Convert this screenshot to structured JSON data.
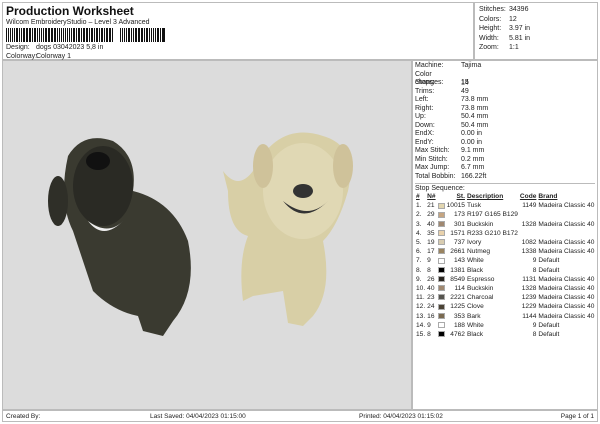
{
  "header": {
    "title": "Production Worksheet",
    "subtitle": "Wilcom EmbroideryStudio – Level 3 Advanced",
    "design_label": "Design:",
    "design_value": "dogs 03042023 5,8 in",
    "colorway_label": "Colorway:",
    "colorway_value": "Colorway 1"
  },
  "stats": [
    {
      "label": "Stitches:",
      "value": "34396"
    },
    {
      "label": "Colors:",
      "value": "12"
    },
    {
      "label": "Height:",
      "value": "3.97 in"
    },
    {
      "label": "Width:",
      "value": "5.81 in"
    },
    {
      "label": "Zoom:",
      "value": "1:1"
    }
  ],
  "info": [
    {
      "label": "Machine:",
      "value": "Tajima"
    },
    {
      "label": "Color changes:",
      "value": "14"
    },
    {
      "label": "Stops:",
      "value": "15"
    },
    {
      "label": "Trims:",
      "value": "49"
    },
    {
      "label": "Left:",
      "value": "73.8 mm"
    },
    {
      "label": "Right:",
      "value": "73.8 mm"
    },
    {
      "label": "Up:",
      "value": "50.4 mm"
    },
    {
      "label": "Down:",
      "value": "50.4 mm"
    },
    {
      "label": "EndX:",
      "value": "0.00 in"
    },
    {
      "label": "EndY:",
      "value": "0.00 in"
    },
    {
      "label": "Max Stitch:",
      "value": "9.1 mm"
    },
    {
      "label": "Min Stitch:",
      "value": "0.2 mm"
    },
    {
      "label": "Max Jump:",
      "value": "6.7 mm"
    },
    {
      "label": "Total Bobbin:",
      "value": "166.22ft"
    }
  ],
  "stop_sequence": {
    "title": "Stop Sequence:",
    "headers": [
      "#",
      "N#",
      "St.",
      "Description",
      "Code",
      "Brand"
    ],
    "rows": [
      [
        "1.",
        "21",
        "10015",
        "Tusk",
        "1149",
        "Madeira Classic 40",
        "#e2d6b0"
      ],
      [
        "2.",
        "29",
        "173",
        "R197 G165 B129",
        "",
        "",
        "#c5a581"
      ],
      [
        "3.",
        "40",
        "301",
        "Buckskin",
        "1328",
        "Madeira Classic 40",
        "#a08870"
      ],
      [
        "4.",
        "35",
        "1571",
        "R233 G210 B172",
        "",
        "",
        "#e9d2ac"
      ],
      [
        "5.",
        "19",
        "737",
        "Ivory",
        "1082",
        "Madeira Classic 40",
        "#d8ccb0"
      ],
      [
        "6.",
        "17",
        "2661",
        "Nutmeg",
        "1338",
        "Madeira Classic 40",
        "#9a8460"
      ],
      [
        "7.",
        "9",
        "143",
        "White",
        "9",
        "Default",
        "#ffffff"
      ],
      [
        "8.",
        "8",
        "1381",
        "Black",
        "8",
        "Default",
        "#000000"
      ],
      [
        "9.",
        "26",
        "8549",
        "Espresso",
        "1131",
        "Madeira Classic 40",
        "#2a2620"
      ],
      [
        "10.",
        "40",
        "114",
        "Buckskin",
        "1328",
        "Madeira Classic 40",
        "#a08870"
      ],
      [
        "11.",
        "23",
        "2221",
        "Charcoal",
        "1239",
        "Madeira Classic 40",
        "#55544e"
      ],
      [
        "12.",
        "24",
        "1225",
        "Clove",
        "1229",
        "Madeira Classic 40",
        "#4a4234"
      ],
      [
        "13.",
        "16",
        "353",
        "Bark",
        "1144",
        "Madeira Classic 40",
        "#7a6a50"
      ],
      [
        "14.",
        "9",
        "188",
        "White",
        "9",
        "Default",
        "#ffffff"
      ],
      [
        "15.",
        "8",
        "4762",
        "Black",
        "8",
        "Default",
        "#000000"
      ]
    ]
  },
  "footer": {
    "created_by": "Created By:",
    "last_saved": "Last Saved: 04/04/2023 01:15:00",
    "printed": "Printed: 04/04/2023 01:15:02",
    "page": "Page 1 of 1"
  }
}
